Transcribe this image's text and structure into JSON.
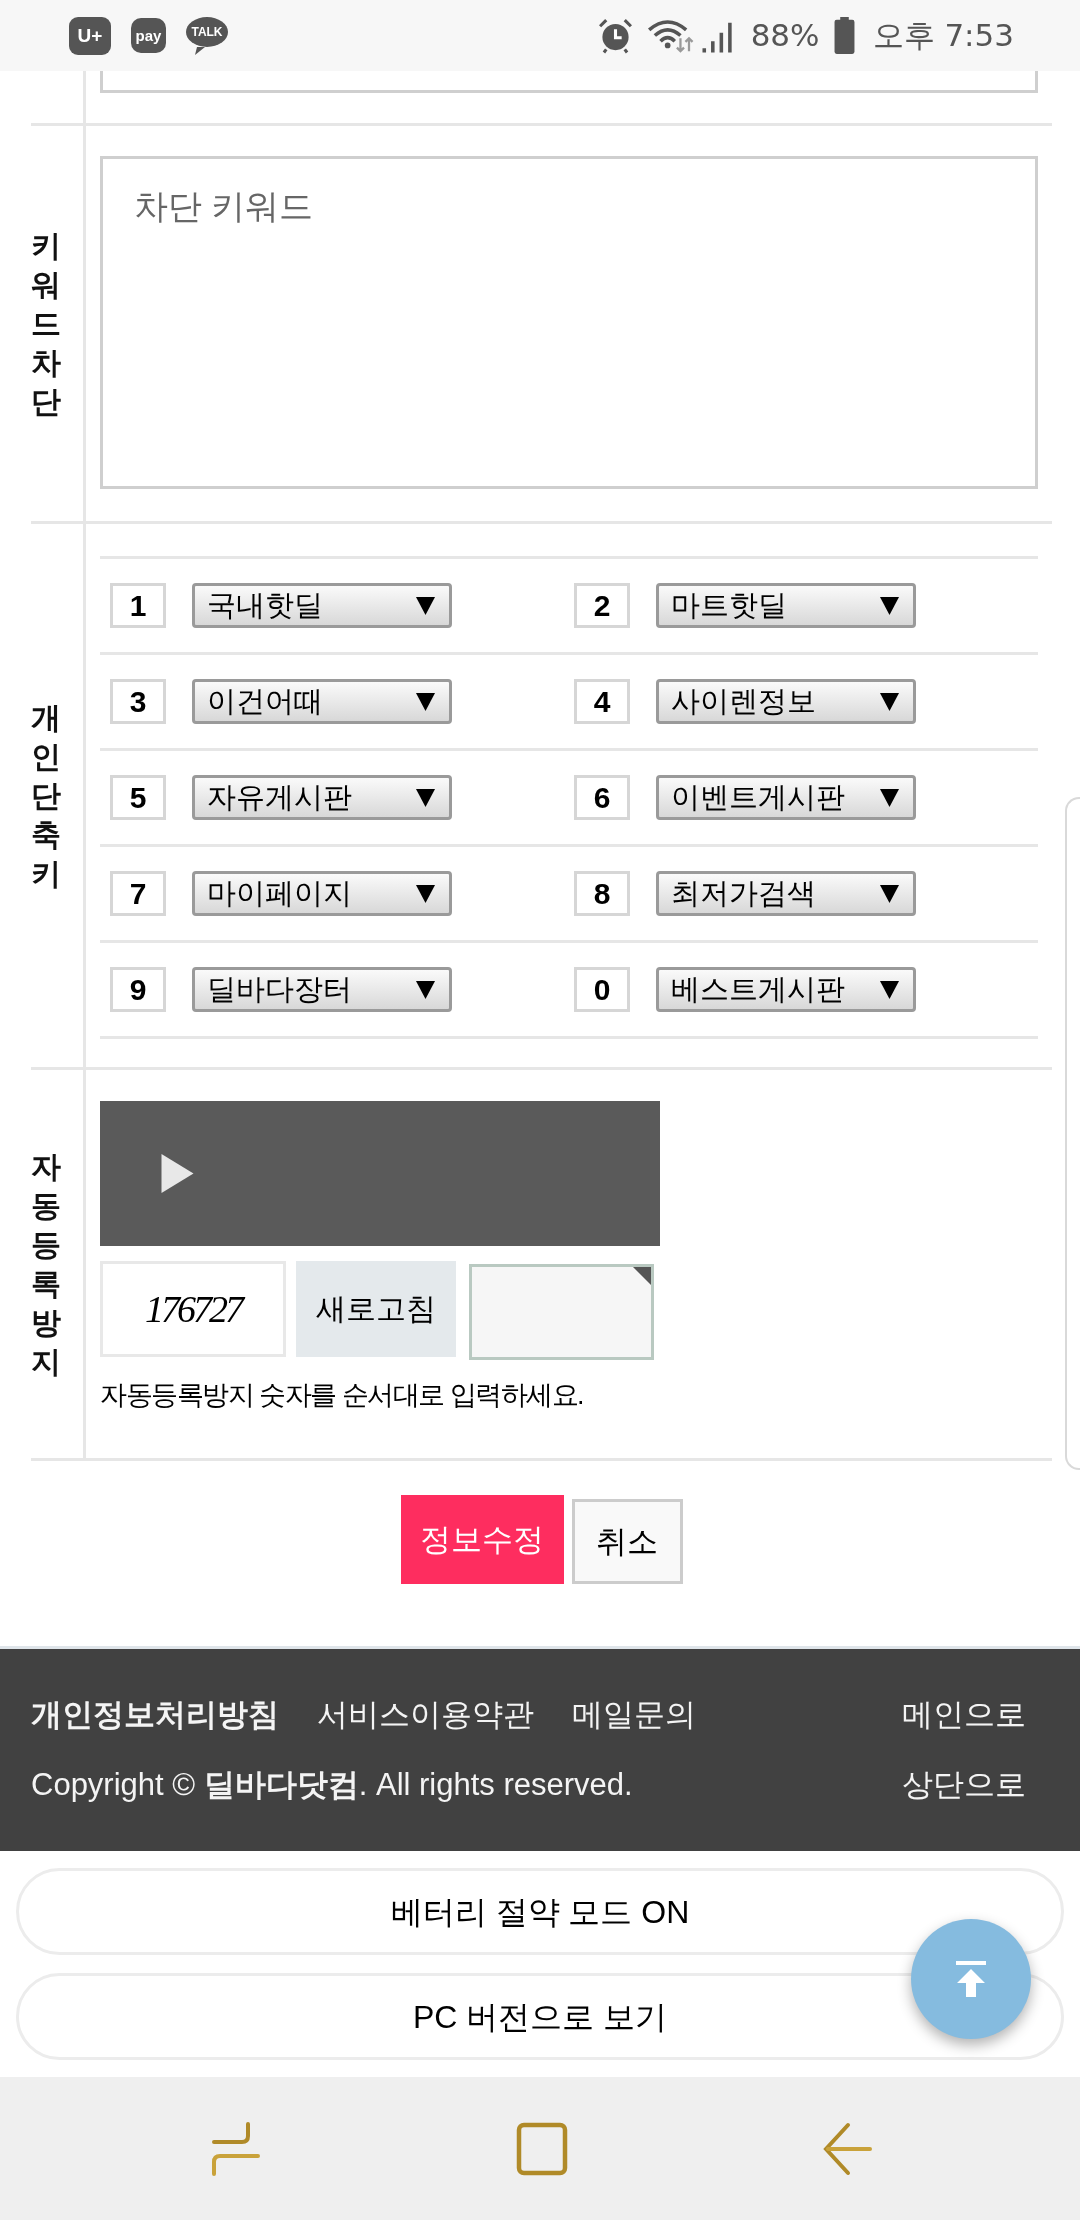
{
  "status_bar": {
    "notifications": [
      {
        "kind": "carrier",
        "label": "U+"
      },
      {
        "kind": "tile",
        "label": "pay"
      },
      {
        "kind": "bubble",
        "label": "TALK"
      }
    ],
    "battery": "88%",
    "time": "오후 7:53"
  },
  "form": {
    "sections": [
      {
        "kind": "keywords",
        "label": "키워드차단",
        "placeholder": "차단 키워드"
      },
      {
        "kind": "shortcuts",
        "label": "개인단축키",
        "shortcuts": [
          {
            "key": "1",
            "board": "국내핫딜"
          },
          {
            "key": "2",
            "board": "마트핫딜"
          },
          {
            "key": "3",
            "board": "이건어때"
          },
          {
            "key": "4",
            "board": "사이렌정보"
          },
          {
            "key": "5",
            "board": "자유게시판"
          },
          {
            "key": "6",
            "board": "이벤트게시판"
          },
          {
            "key": "7",
            "board": "마이페이지"
          },
          {
            "key": "8",
            "board": "최저가검색"
          },
          {
            "key": "9",
            "board": "딜바다장터"
          },
          {
            "key": "0",
            "board": "베스트게시판"
          }
        ]
      },
      {
        "kind": "captcha",
        "label": "자동등록방지",
        "captcha_text": "176727",
        "refresh_button": "새로고침",
        "hint": "자동등록방지 숫자를 순서대로 입력하세요."
      }
    ]
  },
  "actions": [
    {
      "kind": "primary",
      "label": "정보수정"
    },
    {
      "kind": "secondary",
      "label": "취소"
    }
  ],
  "footer": {
    "links": [
      {
        "label": "개인정보처리방침",
        "bold": true
      },
      {
        "label": "서비스이용약관",
        "bold": false
      },
      {
        "label": "메일문의",
        "bold": false
      }
    ],
    "copyright": "Copyright © **딜바다닷컴**. All rights reserved.",
    "side_links": [
      "메인으로",
      "상단으로"
    ]
  },
  "bottom_buttons": [
    "베터리 절약 모드 ON",
    "PC 버전으로 보기"
  ]
}
